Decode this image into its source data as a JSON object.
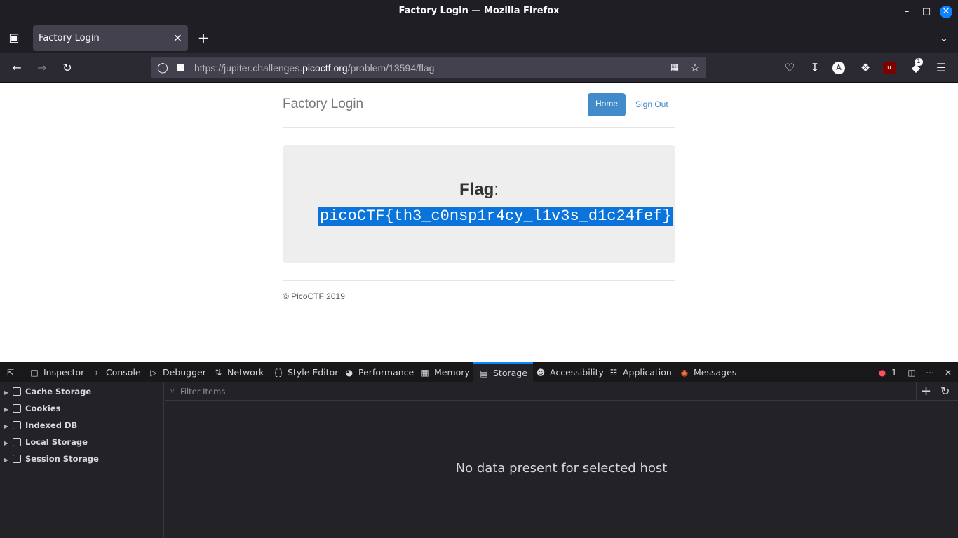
{
  "window": {
    "title": "Factory Login — Mozilla Firefox"
  },
  "tab": {
    "label": "Factory Login"
  },
  "urlbar": {
    "prefix": "https://jupiter.challenges.",
    "domain": "picoctf.org",
    "path": "/problem/13594/flag"
  },
  "toolbar": {
    "extension_badge": "1"
  },
  "page": {
    "brand": "Factory Login",
    "nav": {
      "home": "Home",
      "signout": "Sign Out"
    },
    "flag_label": "Flag",
    "flag_colon": ":",
    "flag_value": "picoCTF{th3_c0nsp1r4cy_l1v3s_d1c24fef}",
    "footer": "© PicoCTF 2019"
  },
  "devtools": {
    "tabs": [
      "Inspector",
      "Console",
      "Debugger",
      "Network",
      "Style Editor",
      "Performance",
      "Memory",
      "Storage",
      "Accessibility",
      "Application",
      "Messages"
    ],
    "active_tab": "Storage",
    "error_count": "1",
    "sidebar": [
      "Cache Storage",
      "Cookies",
      "Indexed DB",
      "Local Storage",
      "Session Storage"
    ],
    "filter_placeholder": "Filter Items",
    "empty_message": "No data present for selected host"
  },
  "colors": {
    "accent": "#0a84ff",
    "button": "#428bca",
    "selection": "#0a74da"
  }
}
